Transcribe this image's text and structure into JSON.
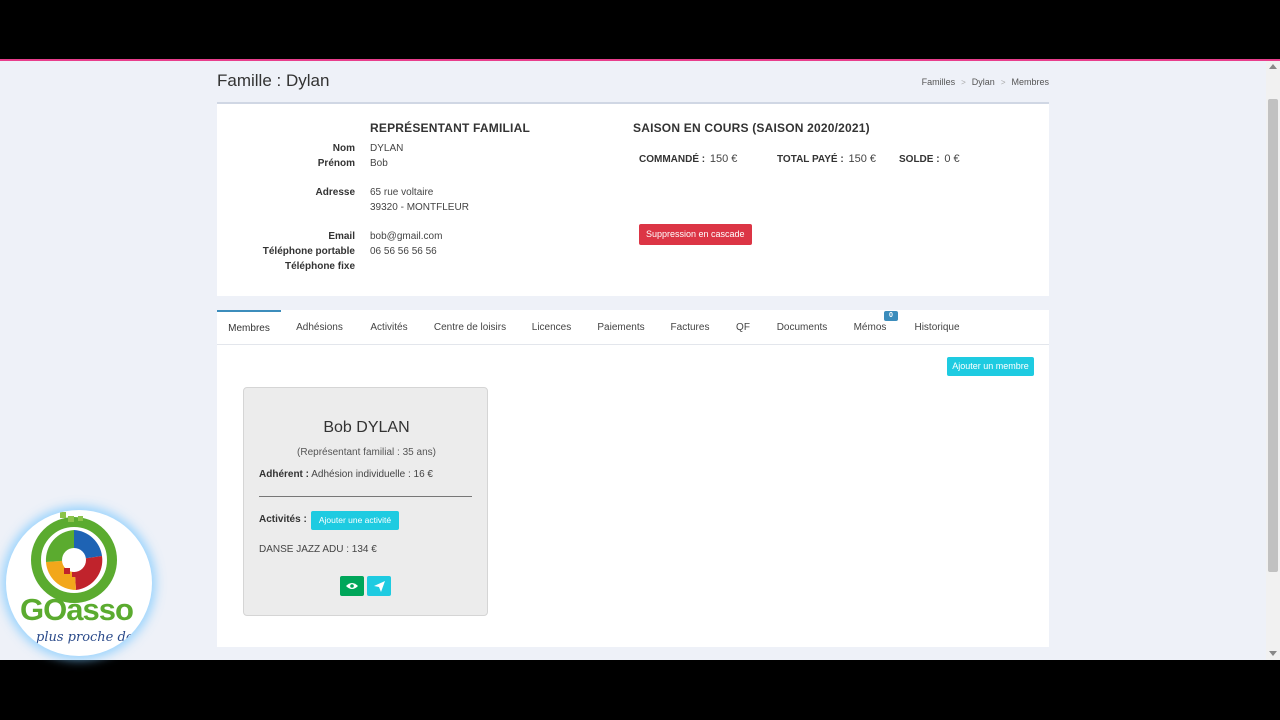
{
  "page": {
    "title": "Famille : Dylan",
    "breadcrumb": [
      "Familles",
      "Dylan",
      "Membres"
    ]
  },
  "representative": {
    "section_title": "REPRÉSENTANT FAMILIAL",
    "nom_label": "Nom",
    "nom_value": "DYLAN",
    "prenom_label": "Prénom",
    "prenom_value": "Bob",
    "adresse_label": "Adresse",
    "adresse_line1": "65 rue voltaire",
    "adresse_line2": "39320 - MONTFLEUR",
    "email_label": "Email",
    "email_value": "bob@gmail.com",
    "tel_portable_label": "Téléphone portable",
    "tel_portable_value": "06 56 56 56 56",
    "tel_fixe_label": "Téléphone fixe"
  },
  "season": {
    "section_title": "SAISON EN COURS (SAISON 2020/2021)",
    "commande_label": "COMMANDÉ :",
    "commande_value": "150 €",
    "total_label": "TOTAL PAYÉ :",
    "total_value": "150 €",
    "solde_label": "SOLDE :",
    "solde_value": "0 €",
    "delete_button": "Suppression en cascade",
    "delete_color": "#dc3545"
  },
  "tabs": {
    "active": "Membres",
    "items": [
      "Membres",
      "Adhésions",
      "Activités",
      "Centre de loisirs",
      "Licences",
      "Paiements",
      "Factures",
      "QF",
      "Documents",
      "Mémos",
      "Historique"
    ],
    "memos_badge": "0"
  },
  "members": {
    "add_button": "Ajouter un membre",
    "card": {
      "name": "Bob DYLAN",
      "role": "(Représentant familial : 35 ans)",
      "adherent_label": "Adhérent :",
      "adherent_value": "Adhésion individuelle : 16 €",
      "activites_label": "Activités :",
      "add_activity_button": "Ajouter une activité",
      "activity": "DANSE JAZZ ADU : 134 €",
      "view_icon": "eye-icon",
      "send_icon": "paper-plane-icon"
    }
  },
  "logo": {
    "text": "GOasso",
    "subtext": "plus proche de"
  },
  "colors": {
    "accent": "#3c8dbc",
    "info": "#1ecbe1",
    "success": "#00a65a",
    "page_bg": "#eef1f8"
  }
}
